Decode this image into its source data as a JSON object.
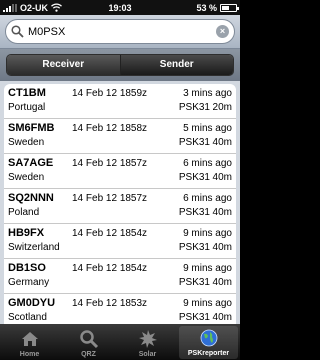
{
  "status": {
    "carrier": "O2-UK",
    "time": "19:03",
    "battery": "53 %"
  },
  "search": {
    "value": "M0PSX"
  },
  "segments": {
    "receiver": "Receiver",
    "sender": "Sender"
  },
  "reports": [
    {
      "call": "CT1BM",
      "date": "14 Feb 12 1859z",
      "ago": "3 mins ago",
      "country": "Portugal",
      "mode": "PSK31",
      "band": "20m"
    },
    {
      "call": "SM6FMB",
      "date": "14 Feb 12 1858z",
      "ago": "5 mins ago",
      "country": "Sweden",
      "mode": "PSK31",
      "band": "40m"
    },
    {
      "call": "SA7AGE",
      "date": "14 Feb 12 1857z",
      "ago": "6 mins ago",
      "country": "Sweden",
      "mode": "PSK31",
      "band": "40m"
    },
    {
      "call": "SQ2NNN",
      "date": "14 Feb 12 1857z",
      "ago": "6 mins ago",
      "country": "Poland",
      "mode": "PSK31",
      "band": "40m"
    },
    {
      "call": "HB9FX",
      "date": "14 Feb 12 1854z",
      "ago": "9 mins ago",
      "country": "Switzerland",
      "mode": "PSK31",
      "band": "40m"
    },
    {
      "call": "DB1SO",
      "date": "14 Feb 12 1854z",
      "ago": "9 mins ago",
      "country": "Germany",
      "mode": "PSK31",
      "band": "40m"
    },
    {
      "call": "GM0DYU",
      "date": "14 Feb 12 1853z",
      "ago": "9 mins ago",
      "country": "Scotland",
      "mode": "PSK31",
      "band": "40m"
    }
  ],
  "tabs": {
    "home": "Home",
    "qrz": "QRZ",
    "solar": "Solar",
    "pskreporter": "PSKreporter"
  }
}
